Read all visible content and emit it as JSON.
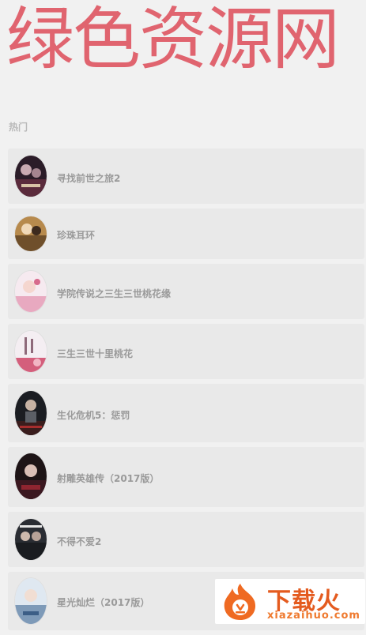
{
  "header": {
    "banner_text": "绿色资源网"
  },
  "section": {
    "label": "热门"
  },
  "items": [
    {
      "title": "寻找前世之旅2",
      "poster_icon": "poster-thumbnail"
    },
    {
      "title": "珍珠耳环",
      "poster_icon": "poster-thumbnail"
    },
    {
      "title": "学院传说之三生三世桃花缘",
      "poster_icon": "poster-thumbnail"
    },
    {
      "title": "三生三世十里桃花",
      "poster_icon": "poster-thumbnail"
    },
    {
      "title": "生化危机5：惩罚",
      "poster_icon": "poster-thumbnail"
    },
    {
      "title": "射雕英雄传（2017版）",
      "poster_icon": "poster-thumbnail"
    },
    {
      "title": "不得不爱2",
      "poster_icon": "poster-thumbnail"
    },
    {
      "title": "星光灿烂（2017版）",
      "poster_icon": "poster-thumbnail"
    }
  ],
  "watermark": {
    "title": "下载火",
    "subtitle": "xiazaihuo.com"
  },
  "colors": {
    "banner": "#e0646f",
    "background": "#f1f1f1",
    "item_bg": "#e9e9e9",
    "item_text": "#9a9a9a",
    "watermark_orange": "#e45b1f"
  }
}
